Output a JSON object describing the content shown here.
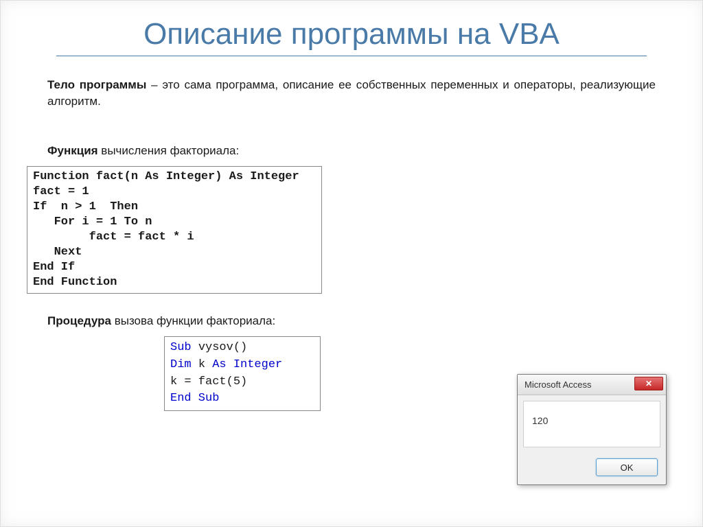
{
  "title": "Описание программы на VBA",
  "description_bold": "Тело программы",
  "description_rest": " – это сама программа, описание ее собственных переменных и операторы, реализующие алгоритм.",
  "subtitle1_bold": "Функция",
  "subtitle1_rest": " вычисления факториала:",
  "code1": "Function fact(n As Integer) As Integer\nfact = 1\nIf  n > 1  Then\n   For i = 1 To n\n        fact = fact * i\n   Next\nEnd If\nEnd Function",
  "subtitle2_bold": "Процедура",
  "subtitle2_rest": " вызова функции факториала:",
  "code2_lines": [
    {
      "blue": "Sub ",
      "plain": "vysov()"
    },
    {
      "blue": "Dim ",
      "plain": "k ",
      "blue2": "As Integer"
    },
    {
      "plain": "k = fact(5)"
    },
    {
      "blue": "End Sub"
    }
  ],
  "dialog": {
    "title": "Microsoft Access",
    "value": "120",
    "ok_label": "OK",
    "close_label": "✕"
  }
}
